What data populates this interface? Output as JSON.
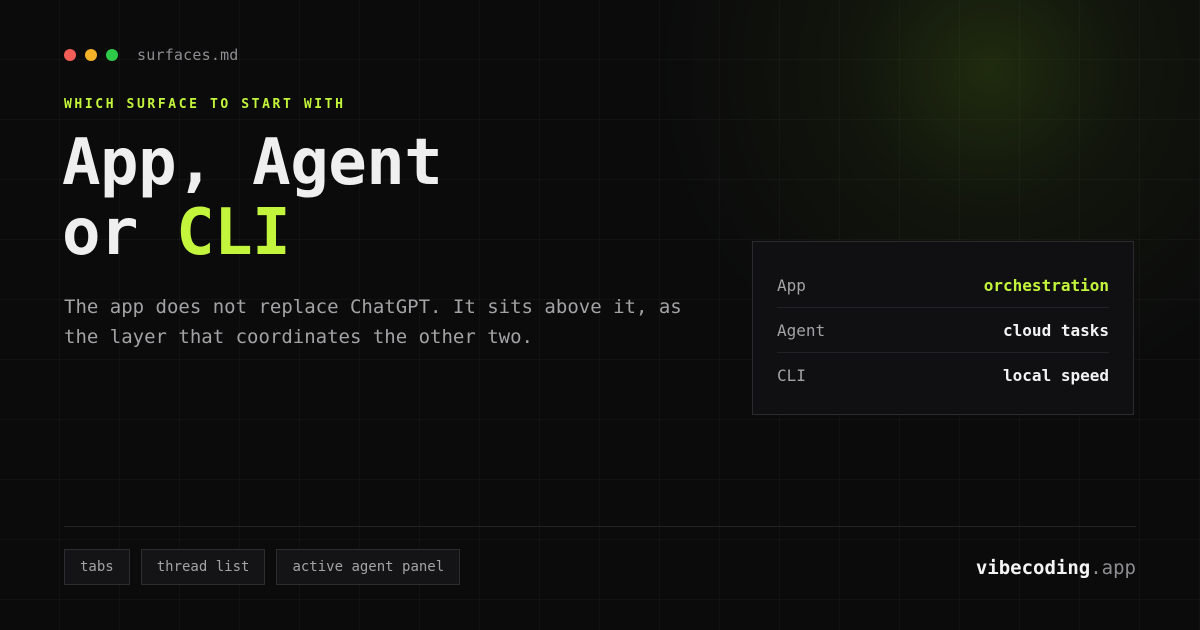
{
  "window": {
    "controls": [
      "close",
      "minimize",
      "maximize"
    ],
    "control_colors": [
      "#f25e57",
      "#f5b228",
      "#2ec949"
    ],
    "file_name": "surfaces.md"
  },
  "eyebrow": "WHICH SURFACE TO START WITH",
  "headline": {
    "line1": "App, Agent",
    "line2_prefix": "or",
    "line2_accent": "CLI"
  },
  "description": "The app does not replace ChatGPT. It sits above it, as the layer that coordinates the other two.",
  "surfaces": [
    {
      "name": "App",
      "role": "orchestration"
    },
    {
      "name": "Agent",
      "role": "cloud tasks"
    },
    {
      "name": "CLI",
      "role": "local speed"
    }
  ],
  "chips": [
    "tabs",
    "thread list",
    "active agent panel"
  ],
  "brand": {
    "name": "vibecoding",
    "tld": ".app"
  },
  "colors": {
    "background": "#0b0b0c",
    "accent": "#c2f53b",
    "text": "#efefef",
    "muted": "#a3a3a6"
  }
}
